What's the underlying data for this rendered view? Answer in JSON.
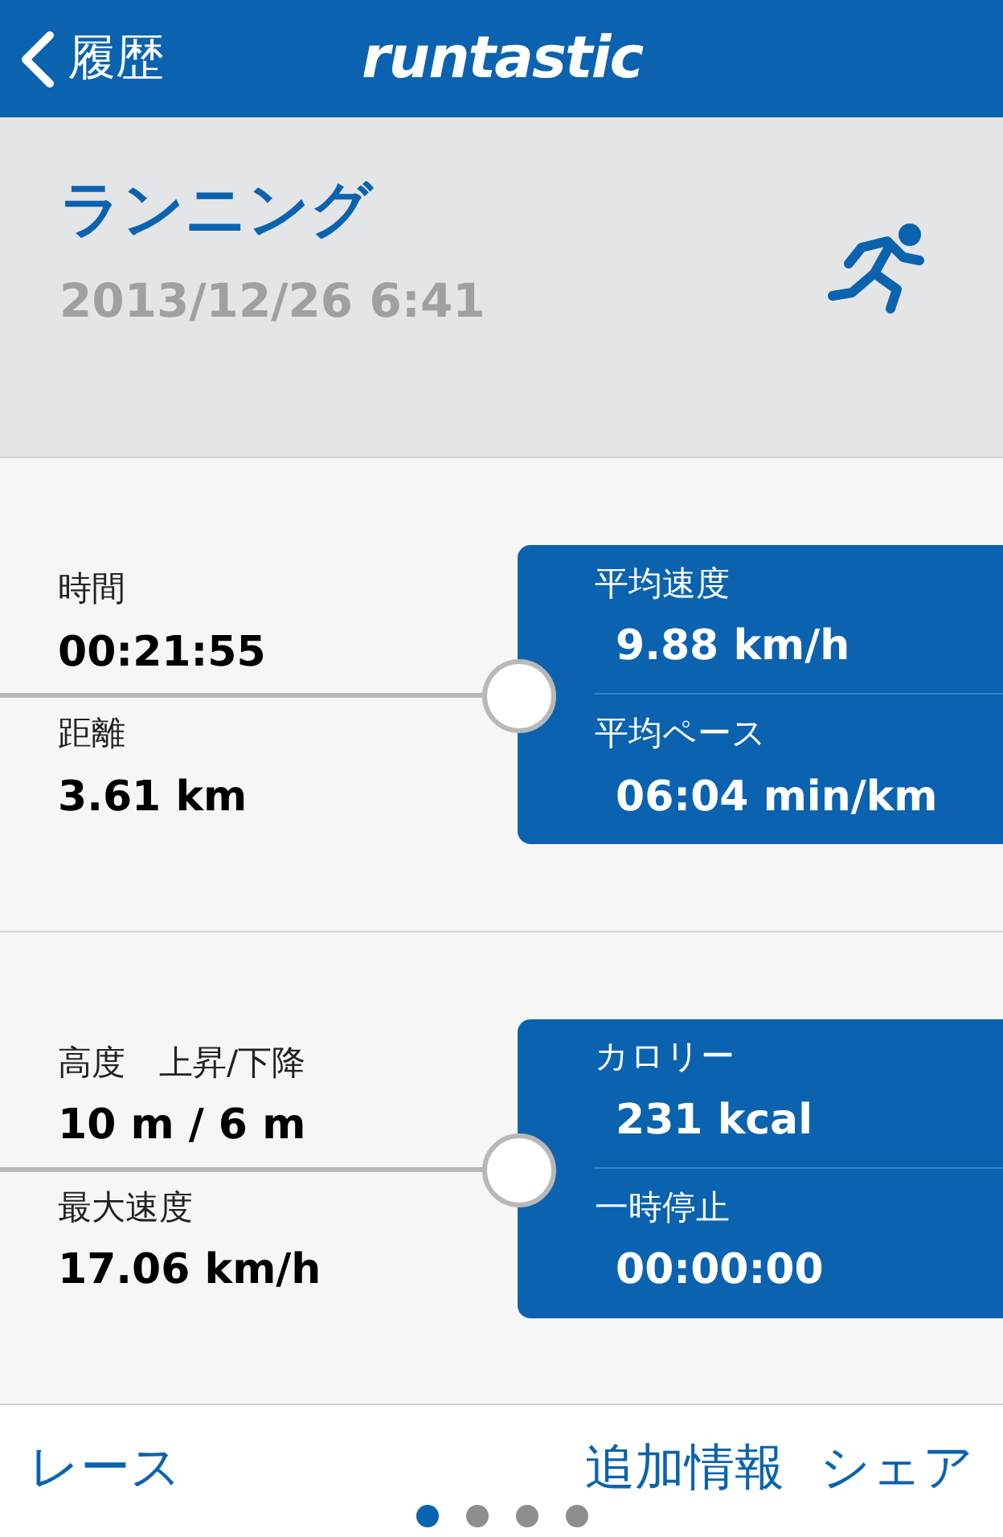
{
  "header": {
    "back": "履歴",
    "logo": "runtastic"
  },
  "activity": {
    "title": "ランニング",
    "date": "2013/12/26 6:41"
  },
  "sections": [
    {
      "left": [
        {
          "label": "時間",
          "value": "00:21:55"
        },
        {
          "label": "距離",
          "value": "3.61 km"
        }
      ],
      "right": [
        {
          "label": "平均速度",
          "value": "9.88 km/h"
        },
        {
          "label": "平均ペース",
          "value": "06:04 min/km"
        }
      ]
    },
    {
      "left": [
        {
          "label": "高度　上昇/下降",
          "value": "10 m / 6 m"
        },
        {
          "label": "最大速度",
          "value": "17.06 km/h"
        }
      ],
      "right": [
        {
          "label": "カロリー",
          "value": "231 kcal"
        },
        {
          "label": "一時停止",
          "value": "00:00:00"
        }
      ]
    }
  ],
  "footer": {
    "left": "レース",
    "right": [
      "追加情報",
      "シェア"
    ],
    "pages": [
      {
        "selected": true
      },
      {
        "selected": false
      },
      {
        "selected": false
      },
      {
        "selected": false
      }
    ]
  }
}
